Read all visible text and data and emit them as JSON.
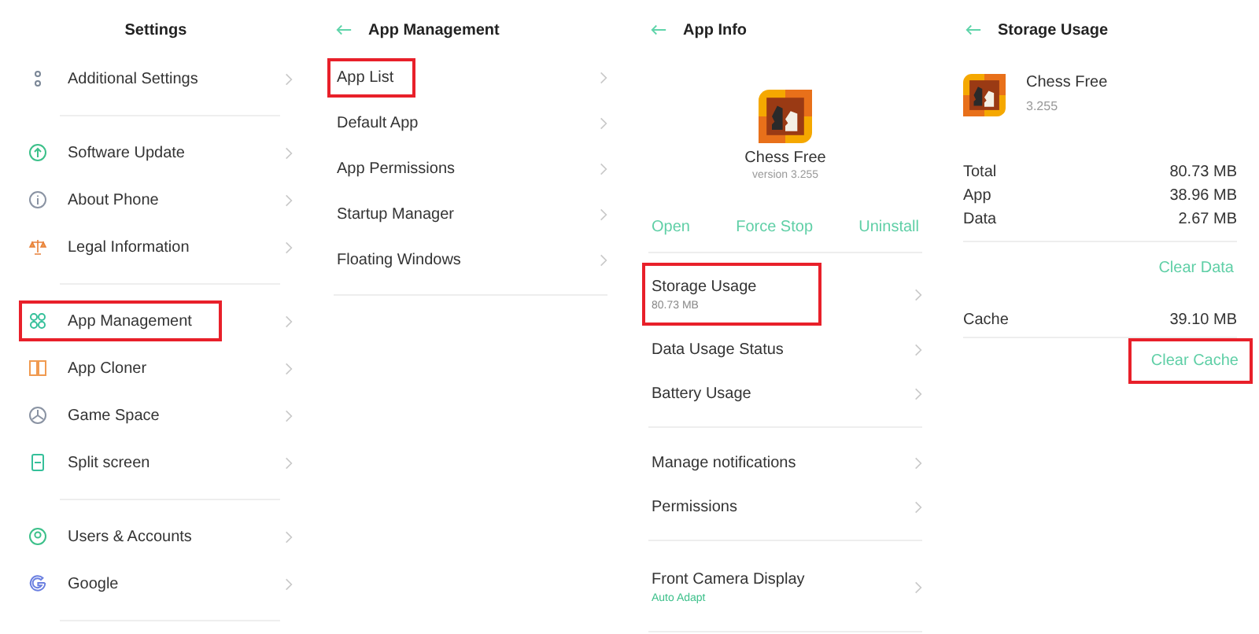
{
  "settings": {
    "title": "Settings",
    "groups": [
      [
        {
          "label": "Additional Settings",
          "kind": "dots",
          "highlighted": false
        }
      ],
      [
        {
          "label": "Software Update",
          "kind": "update",
          "highlighted": false
        },
        {
          "label": "About Phone",
          "kind": "info",
          "highlighted": false
        },
        {
          "label": "Legal Information",
          "kind": "scales",
          "highlighted": false
        }
      ],
      [
        {
          "label": "App Management",
          "kind": "grid",
          "highlighted": true
        },
        {
          "label": "App Cloner",
          "kind": "cloner",
          "highlighted": false
        },
        {
          "label": "Game Space",
          "kind": "game",
          "highlighted": false
        },
        {
          "label": "Split screen",
          "kind": "split",
          "highlighted": false
        }
      ],
      [
        {
          "label": "Users & Accounts",
          "kind": "user",
          "highlighted": false
        },
        {
          "label": "Google",
          "kind": "google",
          "highlighted": false
        }
      ]
    ]
  },
  "app_management": {
    "title": "App Management",
    "items": [
      {
        "label": "App List",
        "highlighted": true
      },
      {
        "label": "Default App",
        "highlighted": false
      },
      {
        "label": "App Permissions",
        "highlighted": false
      },
      {
        "label": "Startup Manager",
        "highlighted": false
      },
      {
        "label": "Floating Windows",
        "highlighted": false
      }
    ]
  },
  "app_info": {
    "title": "App Info",
    "app": {
      "name": "Chess Free",
      "version": "version 3.255"
    },
    "actions": [
      "Open",
      "Force Stop",
      "Uninstall"
    ],
    "groups": [
      [
        {
          "kind": "detail",
          "label": "Storage Usage",
          "subtitle": "80.73 MB",
          "highlighted": true
        },
        {
          "kind": "plain",
          "label": "Data Usage Status",
          "highlighted": false
        },
        {
          "kind": "plain",
          "label": "Battery Usage",
          "highlighted": false
        }
      ],
      [
        {
          "kind": "plain",
          "label": "Manage notifications",
          "highlighted": false
        },
        {
          "kind": "plain",
          "label": "Permissions",
          "highlighted": false
        }
      ],
      [
        {
          "kind": "option",
          "label": "Front Camera Display",
          "subtitle": "Auto Adapt",
          "highlighted": false
        }
      ]
    ]
  },
  "storage_usage": {
    "title": "Storage Usage",
    "app": {
      "name": "Chess Free",
      "version": "3.255"
    },
    "sizes": [
      {
        "label": "Total",
        "value": "80.73 MB"
      },
      {
        "label": "App",
        "value": "38.96 MB"
      },
      {
        "label": "Data",
        "value": "2.67 MB"
      }
    ],
    "clear_data": {
      "label": "Clear Data",
      "highlighted": false
    },
    "cache": {
      "label": "Cache",
      "value": "39.10 MB"
    },
    "clear_cache": {
      "label": "Clear Cache",
      "highlighted": true
    }
  }
}
